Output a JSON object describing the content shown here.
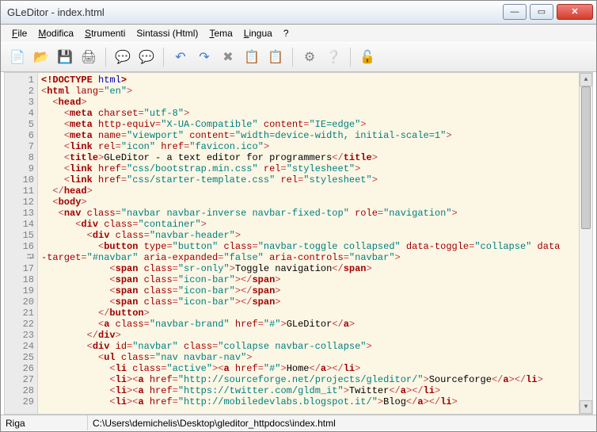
{
  "window": {
    "title": "GLeDitor - index.html"
  },
  "menu": [
    "File",
    "Modifica",
    "Strumenti",
    "Sintassi (Html)",
    "Tema",
    "Lingua",
    "?"
  ],
  "menu_underline": [
    0,
    0,
    0,
    -1,
    0,
    0,
    -1
  ],
  "toolbar_icons": [
    "📄",
    "📂",
    "💾",
    "🖨",
    "|",
    "💬",
    "💬",
    "|",
    "↶",
    "↷",
    "✖",
    "📋",
    "📋",
    "|",
    "⚙",
    "❔",
    "|",
    "🔓"
  ],
  "toolbar_colors": [
    "#5b93d8",
    "#d8a03c",
    "#7a7a7a",
    "#606060",
    "",
    "#7fc96f",
    "#e8a640",
    "",
    "#3a78d8",
    "#3a78d8",
    "#909090",
    "#b0b0b0",
    "#b0b0b0",
    "",
    "#808080",
    "#3a78d8",
    "",
    "#d89a3a"
  ],
  "line_start": 1,
  "line_count": 30,
  "wrap_marker_at": 16,
  "code_lines": [
    [
      [
        "doc",
        "<!DOCTYPE"
      ],
      [
        "kw",
        " html"
      ],
      [
        "doc",
        ">"
      ]
    ],
    [
      [
        "ang",
        "<"
      ],
      [
        "tag",
        "html"
      ],
      [
        "attr",
        " lang"
      ],
      [
        "ang",
        "="
      ],
      [
        "str",
        "\"en\""
      ],
      [
        "ang",
        ">"
      ]
    ],
    [
      [
        "text",
        "  "
      ],
      [
        "ang",
        "<"
      ],
      [
        "tag",
        "head"
      ],
      [
        "ang",
        ">"
      ]
    ],
    [
      [
        "text",
        "    "
      ],
      [
        "ang",
        "<"
      ],
      [
        "tag",
        "meta"
      ],
      [
        "attr",
        " charset"
      ],
      [
        "ang",
        "="
      ],
      [
        "str",
        "\"utf-8\""
      ],
      [
        "ang",
        ">"
      ]
    ],
    [
      [
        "text",
        "    "
      ],
      [
        "ang",
        "<"
      ],
      [
        "tag",
        "meta"
      ],
      [
        "attr",
        " http-equiv"
      ],
      [
        "ang",
        "="
      ],
      [
        "str",
        "\"X-UA-Compatible\""
      ],
      [
        "attr",
        " content"
      ],
      [
        "ang",
        "="
      ],
      [
        "str",
        "\"IE=edge\""
      ],
      [
        "ang",
        ">"
      ]
    ],
    [
      [
        "text",
        "    "
      ],
      [
        "ang",
        "<"
      ],
      [
        "tag",
        "meta"
      ],
      [
        "attr",
        " name"
      ],
      [
        "ang",
        "="
      ],
      [
        "str",
        "\"viewport\""
      ],
      [
        "attr",
        " content"
      ],
      [
        "ang",
        "="
      ],
      [
        "str",
        "\"width=device-width, initial-scale=1\""
      ],
      [
        "ang",
        ">"
      ]
    ],
    [
      [
        "text",
        "    "
      ],
      [
        "ang",
        "<"
      ],
      [
        "tag",
        "link"
      ],
      [
        "attr",
        " rel"
      ],
      [
        "ang",
        "="
      ],
      [
        "str",
        "\"icon\""
      ],
      [
        "attr",
        " href"
      ],
      [
        "ang",
        "="
      ],
      [
        "str",
        "\"favicon.ico\""
      ],
      [
        "ang",
        ">"
      ]
    ],
    [
      [
        "text",
        "    "
      ],
      [
        "ang",
        "<"
      ],
      [
        "tag",
        "title"
      ],
      [
        "ang",
        ">"
      ],
      [
        "text",
        "GLeDitor - a text editor for programmers"
      ],
      [
        "ang",
        "</"
      ],
      [
        "tag",
        "title"
      ],
      [
        "ang",
        ">"
      ]
    ],
    [
      [
        "text",
        "    "
      ],
      [
        "ang",
        "<"
      ],
      [
        "tag",
        "link"
      ],
      [
        "attr",
        " href"
      ],
      [
        "ang",
        "="
      ],
      [
        "str",
        "\"css/bootstrap.min.css\""
      ],
      [
        "attr",
        " rel"
      ],
      [
        "ang",
        "="
      ],
      [
        "str",
        "\"stylesheet\""
      ],
      [
        "ang",
        ">"
      ]
    ],
    [
      [
        "text",
        "    "
      ],
      [
        "ang",
        "<"
      ],
      [
        "tag",
        "link"
      ],
      [
        "attr",
        " href"
      ],
      [
        "ang",
        "="
      ],
      [
        "str",
        "\"css/starter-template.css\""
      ],
      [
        "attr",
        " rel"
      ],
      [
        "ang",
        "="
      ],
      [
        "str",
        "\"stylesheet\""
      ],
      [
        "ang",
        ">"
      ]
    ],
    [
      [
        "text",
        "  "
      ],
      [
        "ang",
        "</"
      ],
      [
        "tag",
        "head"
      ],
      [
        "ang",
        ">"
      ]
    ],
    [
      [
        "text",
        "  "
      ],
      [
        "ang",
        "<"
      ],
      [
        "tag",
        "body"
      ],
      [
        "ang",
        ">"
      ]
    ],
    [
      [
        "text",
        "   "
      ],
      [
        "ang",
        "<"
      ],
      [
        "tag",
        "nav"
      ],
      [
        "attr",
        " class"
      ],
      [
        "ang",
        "="
      ],
      [
        "str",
        "\"navbar navbar-inverse navbar-fixed-top\""
      ],
      [
        "attr",
        " role"
      ],
      [
        "ang",
        "="
      ],
      [
        "str",
        "\"navigation\""
      ],
      [
        "ang",
        ">"
      ]
    ],
    [
      [
        "text",
        "      "
      ],
      [
        "ang",
        "<"
      ],
      [
        "tag",
        "div"
      ],
      [
        "attr",
        " class"
      ],
      [
        "ang",
        "="
      ],
      [
        "str",
        "\"container\""
      ],
      [
        "ang",
        ">"
      ]
    ],
    [
      [
        "text",
        "        "
      ],
      [
        "ang",
        "<"
      ],
      [
        "tag",
        "div"
      ],
      [
        "attr",
        " class"
      ],
      [
        "ang",
        "="
      ],
      [
        "str",
        "\"navbar-header\""
      ],
      [
        "ang",
        ">"
      ]
    ],
    [
      [
        "text",
        "          "
      ],
      [
        "ang",
        "<"
      ],
      [
        "tag",
        "button"
      ],
      [
        "attr",
        " type"
      ],
      [
        "ang",
        "="
      ],
      [
        "str",
        "\"button\""
      ],
      [
        "attr",
        " class"
      ],
      [
        "ang",
        "="
      ],
      [
        "str",
        "\"navbar-toggle collapsed\""
      ],
      [
        "attr",
        " data-toggle"
      ],
      [
        "ang",
        "="
      ],
      [
        "str",
        "\"collapse\""
      ],
      [
        "attr",
        " data"
      ]
    ],
    [
      [
        "attr",
        "-target"
      ],
      [
        "ang",
        "="
      ],
      [
        "str",
        "\"#navbar\""
      ],
      [
        "attr",
        " aria-expanded"
      ],
      [
        "ang",
        "="
      ],
      [
        "str",
        "\"false\""
      ],
      [
        "attr",
        " aria-controls"
      ],
      [
        "ang",
        "="
      ],
      [
        "str",
        "\"navbar\""
      ],
      [
        "ang",
        ">"
      ]
    ],
    [
      [
        "text",
        "            "
      ],
      [
        "ang",
        "<"
      ],
      [
        "tag",
        "span"
      ],
      [
        "attr",
        " class"
      ],
      [
        "ang",
        "="
      ],
      [
        "str",
        "\"sr-only\""
      ],
      [
        "ang",
        ">"
      ],
      [
        "text",
        "Toggle navigation"
      ],
      [
        "ang",
        "</"
      ],
      [
        "tag",
        "span"
      ],
      [
        "ang",
        ">"
      ]
    ],
    [
      [
        "text",
        "            "
      ],
      [
        "ang",
        "<"
      ],
      [
        "tag",
        "span"
      ],
      [
        "attr",
        " class"
      ],
      [
        "ang",
        "="
      ],
      [
        "str",
        "\"icon-bar\""
      ],
      [
        "ang",
        "></"
      ],
      [
        "tag",
        "span"
      ],
      [
        "ang",
        ">"
      ]
    ],
    [
      [
        "text",
        "            "
      ],
      [
        "ang",
        "<"
      ],
      [
        "tag",
        "span"
      ],
      [
        "attr",
        " class"
      ],
      [
        "ang",
        "="
      ],
      [
        "str",
        "\"icon-bar\""
      ],
      [
        "ang",
        "></"
      ],
      [
        "tag",
        "span"
      ],
      [
        "ang",
        ">"
      ]
    ],
    [
      [
        "text",
        "            "
      ],
      [
        "ang",
        "<"
      ],
      [
        "tag",
        "span"
      ],
      [
        "attr",
        " class"
      ],
      [
        "ang",
        "="
      ],
      [
        "str",
        "\"icon-bar\""
      ],
      [
        "ang",
        "></"
      ],
      [
        "tag",
        "span"
      ],
      [
        "ang",
        ">"
      ]
    ],
    [
      [
        "text",
        "          "
      ],
      [
        "ang",
        "</"
      ],
      [
        "tag",
        "button"
      ],
      [
        "ang",
        ">"
      ]
    ],
    [
      [
        "text",
        "          "
      ],
      [
        "ang",
        "<"
      ],
      [
        "tag",
        "a"
      ],
      [
        "attr",
        " class"
      ],
      [
        "ang",
        "="
      ],
      [
        "str",
        "\"navbar-brand\""
      ],
      [
        "attr",
        " href"
      ],
      [
        "ang",
        "="
      ],
      [
        "str",
        "\"#\""
      ],
      [
        "ang",
        ">"
      ],
      [
        "text",
        "GLeDitor"
      ],
      [
        "ang",
        "</"
      ],
      [
        "tag",
        "a"
      ],
      [
        "ang",
        ">"
      ]
    ],
    [
      [
        "text",
        "        "
      ],
      [
        "ang",
        "</"
      ],
      [
        "tag",
        "div"
      ],
      [
        "ang",
        ">"
      ]
    ],
    [
      [
        "text",
        "        "
      ],
      [
        "ang",
        "<"
      ],
      [
        "tag",
        "div"
      ],
      [
        "attr",
        " id"
      ],
      [
        "ang",
        "="
      ],
      [
        "str",
        "\"navbar\""
      ],
      [
        "attr",
        " class"
      ],
      [
        "ang",
        "="
      ],
      [
        "str",
        "\"collapse navbar-collapse\""
      ],
      [
        "ang",
        ">"
      ]
    ],
    [
      [
        "text",
        "          "
      ],
      [
        "ang",
        "<"
      ],
      [
        "tag",
        "ul"
      ],
      [
        "attr",
        " class"
      ],
      [
        "ang",
        "="
      ],
      [
        "str",
        "\"nav navbar-nav\""
      ],
      [
        "ang",
        ">"
      ]
    ],
    [
      [
        "text",
        "            "
      ],
      [
        "ang",
        "<"
      ],
      [
        "tag",
        "li"
      ],
      [
        "attr",
        " class"
      ],
      [
        "ang",
        "="
      ],
      [
        "str",
        "\"active\""
      ],
      [
        "ang",
        "><"
      ],
      [
        "tag",
        "a"
      ],
      [
        "attr",
        " href"
      ],
      [
        "ang",
        "="
      ],
      [
        "str",
        "\"#\""
      ],
      [
        "ang",
        ">"
      ],
      [
        "text",
        "Home"
      ],
      [
        "ang",
        "</"
      ],
      [
        "tag",
        "a"
      ],
      [
        "ang",
        "></"
      ],
      [
        "tag",
        "li"
      ],
      [
        "ang",
        ">"
      ]
    ],
    [
      [
        "text",
        "            "
      ],
      [
        "ang",
        "<"
      ],
      [
        "tag",
        "li"
      ],
      [
        "ang",
        "><"
      ],
      [
        "tag",
        "a"
      ],
      [
        "attr",
        " href"
      ],
      [
        "ang",
        "="
      ],
      [
        "str",
        "\"http://sourceforge.net/projects/gleditor/\""
      ],
      [
        "ang",
        ">"
      ],
      [
        "text",
        "Sourceforge"
      ],
      [
        "ang",
        "</"
      ],
      [
        "tag",
        "a"
      ],
      [
        "ang",
        "></"
      ],
      [
        "tag",
        "li"
      ],
      [
        "ang",
        ">"
      ]
    ],
    [
      [
        "text",
        "            "
      ],
      [
        "ang",
        "<"
      ],
      [
        "tag",
        "li"
      ],
      [
        "ang",
        "><"
      ],
      [
        "tag",
        "a"
      ],
      [
        "attr",
        " href"
      ],
      [
        "ang",
        "="
      ],
      [
        "str",
        "\"https://twitter.com/gldm_it\""
      ],
      [
        "ang",
        ">"
      ],
      [
        "text",
        "Twitter"
      ],
      [
        "ang",
        "</"
      ],
      [
        "tag",
        "a"
      ],
      [
        "ang",
        "></"
      ],
      [
        "tag",
        "li"
      ],
      [
        "ang",
        ">"
      ]
    ],
    [
      [
        "text",
        "            "
      ],
      [
        "ang",
        "<"
      ],
      [
        "tag",
        "li"
      ],
      [
        "ang",
        "><"
      ],
      [
        "tag",
        "a"
      ],
      [
        "attr",
        " href"
      ],
      [
        "ang",
        "="
      ],
      [
        "str",
        "\"http://mobiledevlabs.blogspot.it/\""
      ],
      [
        "ang",
        ">"
      ],
      [
        "text",
        "Blog"
      ],
      [
        "ang",
        "</"
      ],
      [
        "tag",
        "a"
      ],
      [
        "ang",
        "></"
      ],
      [
        "tag",
        "li"
      ],
      [
        "ang",
        ">"
      ]
    ]
  ],
  "status": {
    "label": "Riga",
    "path": "C:\\Users\\demichelis\\Desktop\\gleditor_httpdocs\\index.html"
  }
}
